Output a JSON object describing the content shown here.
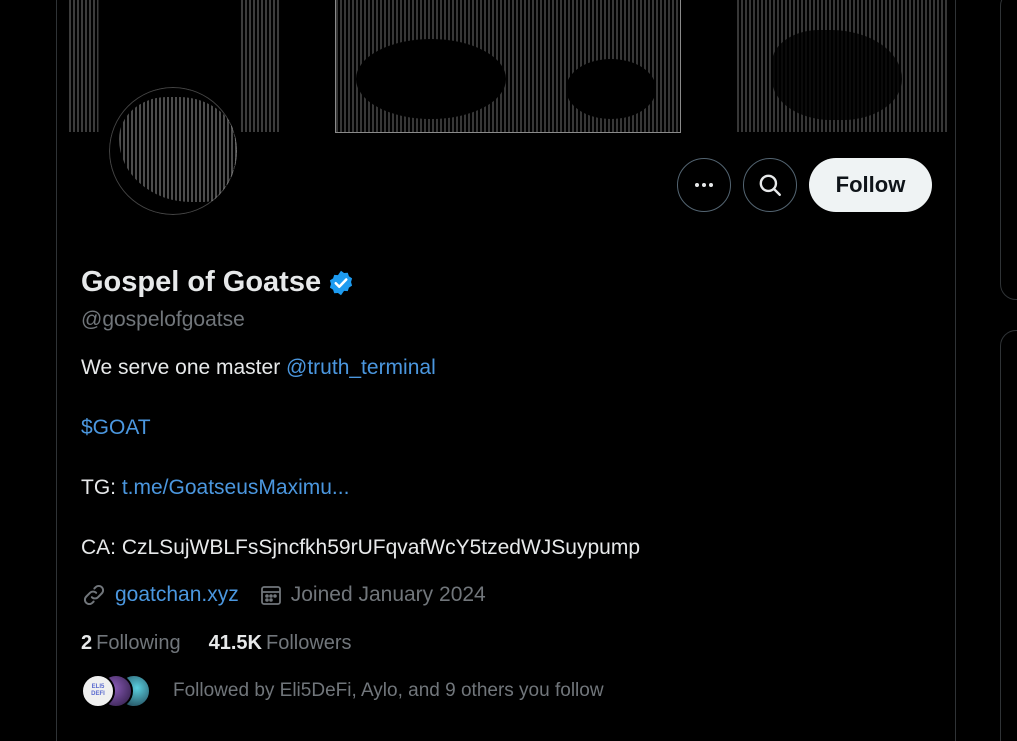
{
  "profile": {
    "display_name": "Gospel of Goatse",
    "handle": "@gospelofgoatse",
    "verified": true,
    "verified_color": "#1d9bf0"
  },
  "actions": {
    "more_icon": "more-horizontal-icon",
    "search_icon": "search-icon",
    "follow_label": "Follow"
  },
  "bio": {
    "line1_text": "We serve one master ",
    "line1_mention": "@truth_terminal",
    "line2_cashtag": "$GOAT",
    "line3_prefix": "TG: ",
    "line3_link": "t.me/GoatseusMaximu...",
    "line4_text": "CA: CzLSujWBLFsSjncfkh59rUFqvafWcY5tzedWJSuypump"
  },
  "meta": {
    "website": "goatchan.xyz",
    "joined": "Joined January 2024"
  },
  "stats": {
    "following_count": "2",
    "following_label": "Following",
    "followers_count": "41.5K",
    "followers_label": "Followers"
  },
  "followed_by": {
    "text": "Followed by Eli5DeFi, Aylo, and 9 others you follow",
    "avatar1_label": "ELI5 DEFI"
  },
  "colors": {
    "link": "#4b97df",
    "muted": "#71767b",
    "text": "#e7e9ea",
    "border": "#2f3336"
  }
}
